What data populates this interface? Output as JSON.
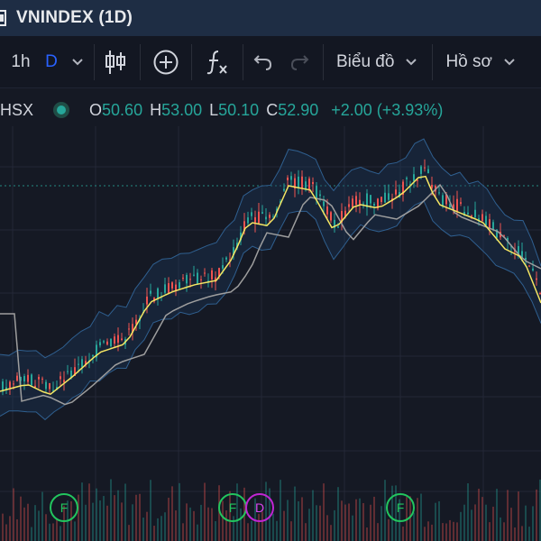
{
  "window": {
    "title": "VNINDEX (1D)"
  },
  "toolbar": {
    "interval_1h": "1h",
    "interval_d": "D",
    "chart_menu": "Biểu đồ",
    "profile_menu": "Hồ sơ",
    "accent": "#2962ff"
  },
  "legend": {
    "symbol": "HSX",
    "open_k": "O",
    "open_v": "50.60",
    "high_k": "H",
    "high_v": "53.00",
    "low_k": "L",
    "low_v": "50.10",
    "close_k": "C",
    "close_v": "52.90",
    "change": "+2.00 (+3.93%)",
    "up_color": "#26a69a",
    "down_color": "#ef5350"
  },
  "events": [
    {
      "label": "F",
      "type": "financial"
    },
    {
      "label": "F",
      "type": "financial"
    },
    {
      "label": "D",
      "type": "dividend"
    },
    {
      "label": "F",
      "type": "financial"
    }
  ]
}
